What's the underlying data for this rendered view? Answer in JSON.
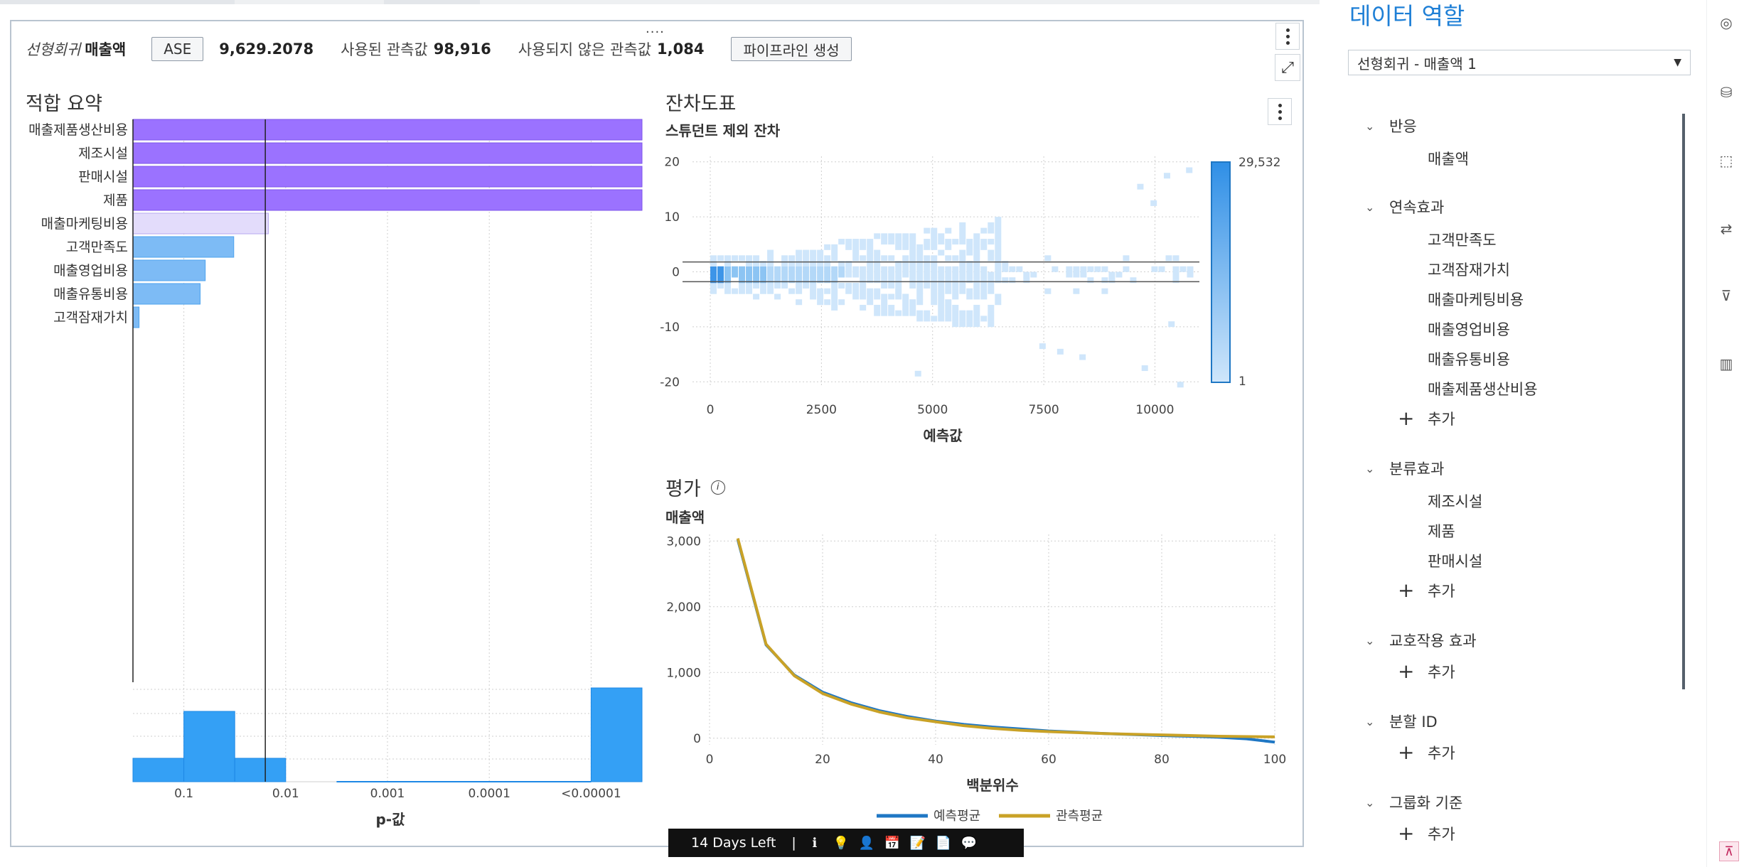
{
  "header": {
    "model_type": "선형회귀",
    "target": "매출액",
    "metric_button": "ASE",
    "metric_value": "9,629.2078",
    "used_obs_label": "사용된 관측값",
    "used_obs_value": "98,916",
    "unused_obs_label": "사용되지 않은 관측값",
    "unused_obs_value": "1,084",
    "pipeline_button": "파이프라인 생성",
    "drag_handle": "....",
    "menu_icon": "kebab-menu-icon",
    "expand_icon": "expand-icon"
  },
  "fit_summary": {
    "title": "적합 요약",
    "xlabel": "p-값",
    "tick_labels": [
      "0.1",
      "0.01",
      "0.001",
      "0.0001",
      "<0.00001"
    ],
    "variables": [
      "매출제품생산비용",
      "제조시설",
      "판매시설",
      "제품",
      "매출마케팅비용",
      "고객만족도",
      "매출영업비용",
      "매출유통비용",
      "고객잠재가치"
    ],
    "bar_ends": [
      5.0,
      5.0,
      5.0,
      5.0,
      1.33,
      0.99,
      0.71,
      0.66,
      0.06
    ],
    "reference_line": 1.3,
    "colors": {
      "significant": "#9b72ff",
      "faded": "#e3dcfb",
      "nonsig": "#7dbbf5"
    }
  },
  "residual_plot": {
    "title": "잔차도표",
    "subtitle": "스튜던트 제외 잔차",
    "xlabel": "예측값",
    "x_ticks": [
      "0",
      "2500",
      "5000",
      "7500",
      "10000"
    ],
    "y_ticks": [
      "20",
      "10",
      "0",
      "-10",
      "-20"
    ],
    "legend_max": "29,532",
    "legend_min": "1",
    "menu_icon": "kebab-menu-icon"
  },
  "evaluation": {
    "title": "평가",
    "info_icon": "info-icon",
    "subtitle": "매출액",
    "xlabel": "백분위수",
    "x_ticks": [
      "0",
      "20",
      "40",
      "60",
      "80",
      "100"
    ],
    "y_ticks": [
      "3,000",
      "2,000",
      "1,000",
      "0"
    ],
    "legend": [
      {
        "name": "예측평균",
        "color": "#1f77c4"
      },
      {
        "name": "관측평균",
        "color": "#c9a227"
      }
    ]
  },
  "chart_data": [
    {
      "type": "bar",
      "title": "적합 요약",
      "xlabel": "p-값",
      "categories": [
        "매출제품생산비용",
        "제조시설",
        "판매시설",
        "제품",
        "매출마케팅비용",
        "고객만족도",
        "매출영업비용",
        "매출유통비용",
        "고객잠재가치"
      ],
      "values": [
        5.0,
        5.0,
        5.0,
        5.0,
        1.33,
        0.99,
        0.71,
        0.66,
        0.06
      ],
      "x_ticks": [
        "0.1",
        "0.01",
        "0.001",
        "0.0001",
        "<0.00001"
      ],
      "histogram": {
        "bins": [
          0,
          0.5,
          1,
          1.5,
          2,
          2.5,
          3,
          3.5,
          4,
          4.5,
          5
        ],
        "counts": [
          1,
          3,
          1,
          0,
          0,
          0,
          0,
          0,
          0,
          4
        ]
      }
    },
    {
      "type": "heatmap",
      "title": "잔차도표",
      "subtitle": "스튜던트 제외 잔차",
      "xlabel": "예측값",
      "xlim": [
        -400,
        11000
      ],
      "ylim": [
        -21,
        21
      ],
      "color_range": [
        1,
        29532
      ],
      "reference_lines_y": [
        1.8,
        -1.8
      ]
    },
    {
      "type": "line",
      "title": "평가",
      "subtitle": "매출액",
      "xlabel": "백분위수",
      "xlim": [
        0,
        100
      ],
      "ylim": [
        -100,
        3100
      ],
      "x": [
        5,
        10,
        15,
        20,
        25,
        30,
        35,
        40,
        45,
        50,
        55,
        60,
        65,
        70,
        75,
        80,
        85,
        90,
        95,
        100
      ],
      "series": [
        {
          "name": "예측평균",
          "values": [
            3020,
            1420,
            960,
            700,
            540,
            420,
            330,
            260,
            210,
            170,
            140,
            110,
            90,
            70,
            55,
            40,
            30,
            15,
            -10,
            -60
          ]
        },
        {
          "name": "관측평균",
          "values": [
            3040,
            1430,
            950,
            680,
            520,
            400,
            310,
            250,
            190,
            150,
            120,
            100,
            85,
            70,
            60,
            50,
            40,
            30,
            25,
            20
          ]
        }
      ]
    }
  ],
  "right_panel": {
    "title": "데이터 역할",
    "model_select": "선형회귀 - 매출액 1",
    "sections": {
      "response": {
        "label": "반응",
        "items": [
          "매출액"
        ]
      },
      "continuous": {
        "label": "연속효과",
        "items": [
          "고객만족도",
          "고객잠재가치",
          "매출마케팅비용",
          "매출영업비용",
          "매출유통비용",
          "매출제품생산비용"
        ],
        "add": "추가"
      },
      "classification": {
        "label": "분류효과",
        "items": [
          "제조시설",
          "제품",
          "판매시설"
        ],
        "add": "추가"
      },
      "interaction": {
        "label": "교호작용 효과",
        "add": "추가"
      },
      "partition": {
        "label": "분할 ID",
        "add": "추가"
      },
      "groupby": {
        "label": "그룹화 기준",
        "add": "추가"
      }
    }
  },
  "trial_bar": {
    "text": "14 Days Left",
    "separator": "|",
    "icons": [
      "info-icon",
      "lightbulb-icon",
      "user-icon",
      "calendar-icon",
      "certificate-icon",
      "document-icon",
      "chat-icon"
    ]
  },
  "side_toolbar": {
    "icons": [
      "palette-icon",
      "data-icon",
      "select-icon",
      "options-icon",
      "filter-icon",
      "chart-type-icon",
      "pin-icon"
    ]
  }
}
